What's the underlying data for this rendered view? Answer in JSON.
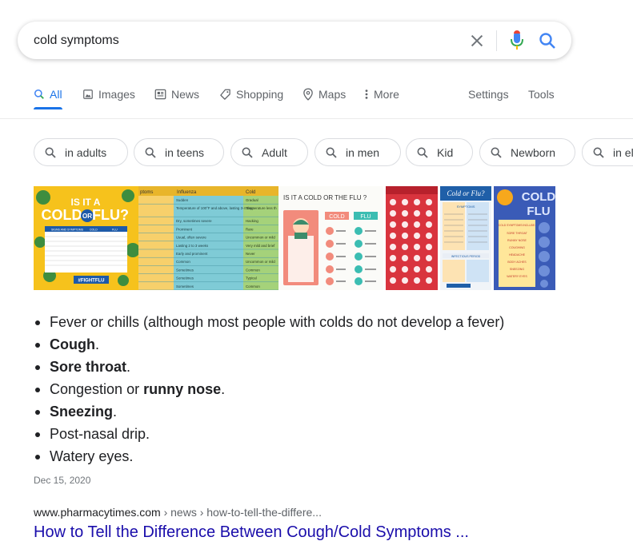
{
  "search": {
    "query": "cold symptoms",
    "clear_icon": "close-icon",
    "mic_icon": "microphone-icon",
    "search_icon": "search-icon"
  },
  "tabs": {
    "all": "All",
    "images": "Images",
    "news": "News",
    "shopping": "Shopping",
    "maps": "Maps",
    "more": "More",
    "settings": "Settings",
    "tools": "Tools",
    "active": "All"
  },
  "chips": [
    "in adults",
    "in teens",
    "Adult",
    "in men",
    "Kid",
    "Newborn",
    "in el"
  ],
  "images": {
    "img1": {
      "line1": "IS IT A",
      "line2a": "COLD",
      "line2b": "OR",
      "line2c": "FLU?",
      "table_head": [
        "SIGNS AND SYMPTOMS",
        "COLD",
        "FLU"
      ],
      "footer": "#FIGHTFLU"
    },
    "img2": {
      "headers": [
        "ptoms",
        "Influenza",
        "Cold"
      ],
      "col1": [
        "Sudden",
        "Temperature of 100°F and above, lasting 3-4 days",
        "Dry, sometimes severe",
        "Prominent",
        "Usual, often severe",
        "Lasting 2 to 3 weeks",
        "Early and prominent",
        "Common",
        "Sometimes",
        "Sometimes",
        "Sometimes"
      ],
      "col2": [
        "Gradual",
        "Temperature less th",
        "Hacking",
        "Rare",
        "Uncommon or mild",
        "Very mild and brief",
        "Never",
        "Uncommon or mild",
        "Common",
        "Typical",
        "Common"
      ]
    },
    "img3": {
      "title": "IS IT A COLD OR THE FLU ?",
      "cold": "COLD",
      "flu": "FLU"
    },
    "img5": {
      "title": "Cold or Flu?",
      "sub": "SYMPTOMS",
      "section": "INFECTIOUS PERIOD"
    },
    "img6": {
      "title1": "COLD",
      "title2": "FLU",
      "list_head": "COLD SYMPTOMS INCLUDE:",
      "list": [
        "SORE THROAT",
        "RUNNY NOSE",
        "COUGHING",
        "HEADACHE",
        "BODY ACHES",
        "SNEEZING",
        "WATERY EYES"
      ]
    }
  },
  "snippet": {
    "items": [
      {
        "pre": "Fever or chills (although most people with colds do not develop a fever)",
        "bold": "",
        "post": ""
      },
      {
        "pre": "",
        "bold": "Cough",
        "post": "."
      },
      {
        "pre": "",
        "bold": "Sore throat",
        "post": "."
      },
      {
        "pre": "Congestion or ",
        "bold": "runny nose",
        "post": "."
      },
      {
        "pre": "",
        "bold": "Sneezing",
        "post": "."
      },
      {
        "pre": "Post-nasal drip.",
        "bold": "",
        "post": ""
      },
      {
        "pre": "Watery eyes.",
        "bold": "",
        "post": ""
      }
    ],
    "date": "Dec 15, 2020"
  },
  "result": {
    "domain": "www.pharmacytimes.com",
    "path": " › news › how-to-tell-the-differe...",
    "title": "How to Tell the Difference Between Cough/Cold Symptoms ..."
  },
  "colors": {
    "link_blue": "#1a0dab",
    "accent_blue": "#1a73e8",
    "mic_red": "#ea4335",
    "muted": "#5f6368"
  }
}
